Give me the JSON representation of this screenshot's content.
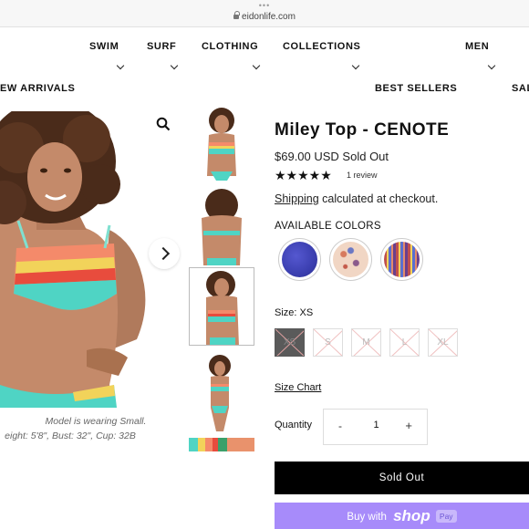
{
  "browser": {
    "url": "eidonlife.com",
    "dots": "•••"
  },
  "nav": {
    "items": [
      "SWIM",
      "SURF",
      "CLOTHING",
      "COLLECTIONS",
      "MEN"
    ],
    "row2": [
      "EW ARRIVALS",
      "BEST SELLERS",
      "SAL"
    ]
  },
  "gallery": {
    "caption1": "Model is wearing Small.",
    "caption2": "eight: 5'8\", Bust: 32\", Cup: 32B"
  },
  "product": {
    "title": "Miley Top - CENOTE",
    "price": "$69.00 USD Sold Out",
    "stars": "★★★★★",
    "reviews": "1 review",
    "shipping_link": "Shipping",
    "shipping_rest": " calculated at checkout.",
    "colors_label": "AVAILABLE COLORS",
    "colors": [
      "#3b3fb0",
      "#e8c4b0",
      "#c0504d"
    ],
    "size_label": "Size:  XS",
    "sizes": [
      "XS",
      "S",
      "M",
      "L",
      "XL"
    ],
    "size_chart": "Size Chart",
    "quantity_label": "Quantity",
    "quantity": {
      "minus": "-",
      "value": "1",
      "plus": "+"
    },
    "sold_out": "Sold Out",
    "buy_with": "Buy with",
    "shop": "shop",
    "pay": "Pay"
  }
}
